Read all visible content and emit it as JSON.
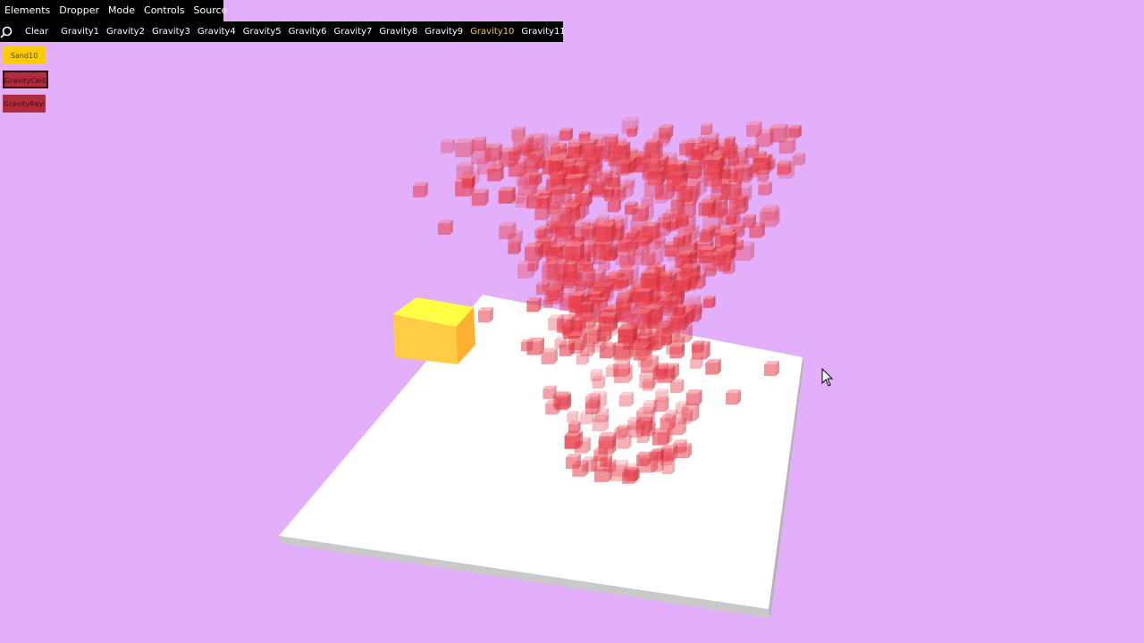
{
  "menu": {
    "items": [
      {
        "label": "Elements",
        "active": true
      },
      {
        "label": "Dropper",
        "active": false
      },
      {
        "label": "Mode",
        "active": false
      },
      {
        "label": "Controls",
        "active": false
      },
      {
        "label": "Source",
        "active": false
      }
    ]
  },
  "toolbar": {
    "search_icon": "search-icon",
    "clear_label": "Clear",
    "items": [
      "Gravity1",
      "Gravity2",
      "Gravity3",
      "Gravity4",
      "Gravity5",
      "Gravity6",
      "Gravity7",
      "Gravity8",
      "Gravity9",
      "Gravity10",
      "Gravity11"
    ],
    "selected": "Gravity10"
  },
  "palette": {
    "items": [
      {
        "label": "Sand10",
        "color": "#ffcc00"
      },
      {
        "label": "GravityCeiling",
        "color": "#b22c3c"
      },
      {
        "label": "GravityRays",
        "color": "#b22c3c"
      }
    ]
  },
  "colors": {
    "background": "#e3aefa",
    "floor_top": "#ffffff",
    "floor_side": "#c8c8c8",
    "particle": "#e8414e",
    "sand_block": "#ffd640"
  },
  "scene": {
    "cursor_icon": "mouse-pointer-icon"
  }
}
